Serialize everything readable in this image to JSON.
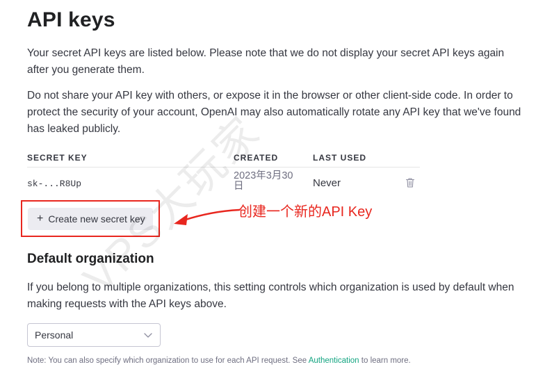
{
  "page": {
    "title": "API keys",
    "intro": "Your secret API keys are listed below. Please note that we do not display your secret API keys again after you generate them.",
    "warning": "Do not share your API key with others, or expose it in the browser or other client-side code. In order to protect the security of your account, OpenAI may also automatically rotate any API key that we've found has leaked publicly."
  },
  "keys_table": {
    "headers": {
      "secret_key": "SECRET KEY",
      "created": "CREATED",
      "last_used": "LAST USED"
    },
    "rows": [
      {
        "key": "sk-...R8Up",
        "created": "2023年3月30日",
        "last_used": "Never",
        "delete_icon": "trash-icon"
      }
    ]
  },
  "create_button": {
    "icon": "+",
    "label": "Create new secret key"
  },
  "annotation": {
    "text": "创建一个新的API Key",
    "color": "#e8261e"
  },
  "default_org": {
    "title": "Default organization",
    "description": "If you belong to multiple organizations, this setting controls which organization is used by default when making requests with the API keys above.",
    "selected": "Personal",
    "chevron_icon": "chevron-down-icon"
  },
  "note": {
    "prefix": "Note: You can also specify which organization to use for each API request. See",
    "link": "Authentication",
    "suffix": "to learn more."
  },
  "watermark": {
    "text": "VPS大玩家"
  },
  "colors": {
    "accent_link": "#10a37f",
    "annotation_red": "#e8261e",
    "button_bg": "#ececf1"
  }
}
